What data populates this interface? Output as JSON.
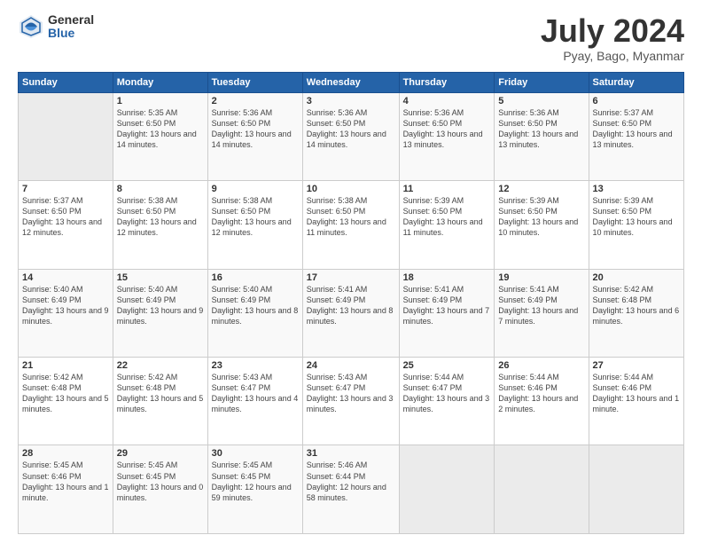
{
  "header": {
    "logo_general": "General",
    "logo_blue": "Blue",
    "title": "July 2024",
    "location": "Pyay, Bago, Myanmar"
  },
  "days_of_week": [
    "Sunday",
    "Monday",
    "Tuesday",
    "Wednesday",
    "Thursday",
    "Friday",
    "Saturday"
  ],
  "weeks": [
    [
      {
        "day": "",
        "info": ""
      },
      {
        "day": "1",
        "info": "Sunrise: 5:35 AM\nSunset: 6:50 PM\nDaylight: 13 hours\nand 14 minutes."
      },
      {
        "day": "2",
        "info": "Sunrise: 5:36 AM\nSunset: 6:50 PM\nDaylight: 13 hours\nand 14 minutes."
      },
      {
        "day": "3",
        "info": "Sunrise: 5:36 AM\nSunset: 6:50 PM\nDaylight: 13 hours\nand 14 minutes."
      },
      {
        "day": "4",
        "info": "Sunrise: 5:36 AM\nSunset: 6:50 PM\nDaylight: 13 hours\nand 13 minutes."
      },
      {
        "day": "5",
        "info": "Sunrise: 5:36 AM\nSunset: 6:50 PM\nDaylight: 13 hours\nand 13 minutes."
      },
      {
        "day": "6",
        "info": "Sunrise: 5:37 AM\nSunset: 6:50 PM\nDaylight: 13 hours\nand 13 minutes."
      }
    ],
    [
      {
        "day": "7",
        "info": "Sunrise: 5:37 AM\nSunset: 6:50 PM\nDaylight: 13 hours\nand 12 minutes."
      },
      {
        "day": "8",
        "info": "Sunrise: 5:38 AM\nSunset: 6:50 PM\nDaylight: 13 hours\nand 12 minutes."
      },
      {
        "day": "9",
        "info": "Sunrise: 5:38 AM\nSunset: 6:50 PM\nDaylight: 13 hours\nand 12 minutes."
      },
      {
        "day": "10",
        "info": "Sunrise: 5:38 AM\nSunset: 6:50 PM\nDaylight: 13 hours\nand 11 minutes."
      },
      {
        "day": "11",
        "info": "Sunrise: 5:39 AM\nSunset: 6:50 PM\nDaylight: 13 hours\nand 11 minutes."
      },
      {
        "day": "12",
        "info": "Sunrise: 5:39 AM\nSunset: 6:50 PM\nDaylight: 13 hours\nand 10 minutes."
      },
      {
        "day": "13",
        "info": "Sunrise: 5:39 AM\nSunset: 6:50 PM\nDaylight: 13 hours\nand 10 minutes."
      }
    ],
    [
      {
        "day": "14",
        "info": "Sunrise: 5:40 AM\nSunset: 6:49 PM\nDaylight: 13 hours\nand 9 minutes."
      },
      {
        "day": "15",
        "info": "Sunrise: 5:40 AM\nSunset: 6:49 PM\nDaylight: 13 hours\nand 9 minutes."
      },
      {
        "day": "16",
        "info": "Sunrise: 5:40 AM\nSunset: 6:49 PM\nDaylight: 13 hours\nand 8 minutes."
      },
      {
        "day": "17",
        "info": "Sunrise: 5:41 AM\nSunset: 6:49 PM\nDaylight: 13 hours\nand 8 minutes."
      },
      {
        "day": "18",
        "info": "Sunrise: 5:41 AM\nSunset: 6:49 PM\nDaylight: 13 hours\nand 7 minutes."
      },
      {
        "day": "19",
        "info": "Sunrise: 5:41 AM\nSunset: 6:49 PM\nDaylight: 13 hours\nand 7 minutes."
      },
      {
        "day": "20",
        "info": "Sunrise: 5:42 AM\nSunset: 6:48 PM\nDaylight: 13 hours\nand 6 minutes."
      }
    ],
    [
      {
        "day": "21",
        "info": "Sunrise: 5:42 AM\nSunset: 6:48 PM\nDaylight: 13 hours\nand 5 minutes."
      },
      {
        "day": "22",
        "info": "Sunrise: 5:42 AM\nSunset: 6:48 PM\nDaylight: 13 hours\nand 5 minutes."
      },
      {
        "day": "23",
        "info": "Sunrise: 5:43 AM\nSunset: 6:47 PM\nDaylight: 13 hours\nand 4 minutes."
      },
      {
        "day": "24",
        "info": "Sunrise: 5:43 AM\nSunset: 6:47 PM\nDaylight: 13 hours\nand 3 minutes."
      },
      {
        "day": "25",
        "info": "Sunrise: 5:44 AM\nSunset: 6:47 PM\nDaylight: 13 hours\nand 3 minutes."
      },
      {
        "day": "26",
        "info": "Sunrise: 5:44 AM\nSunset: 6:46 PM\nDaylight: 13 hours\nand 2 minutes."
      },
      {
        "day": "27",
        "info": "Sunrise: 5:44 AM\nSunset: 6:46 PM\nDaylight: 13 hours\nand 1 minute."
      }
    ],
    [
      {
        "day": "28",
        "info": "Sunrise: 5:45 AM\nSunset: 6:46 PM\nDaylight: 13 hours\nand 1 minute."
      },
      {
        "day": "29",
        "info": "Sunrise: 5:45 AM\nSunset: 6:45 PM\nDaylight: 13 hours\nand 0 minutes."
      },
      {
        "day": "30",
        "info": "Sunrise: 5:45 AM\nSunset: 6:45 PM\nDaylight: 12 hours\nand 59 minutes."
      },
      {
        "day": "31",
        "info": "Sunrise: 5:46 AM\nSunset: 6:44 PM\nDaylight: 12 hours\nand 58 minutes."
      },
      {
        "day": "",
        "info": ""
      },
      {
        "day": "",
        "info": ""
      },
      {
        "day": "",
        "info": ""
      }
    ]
  ]
}
